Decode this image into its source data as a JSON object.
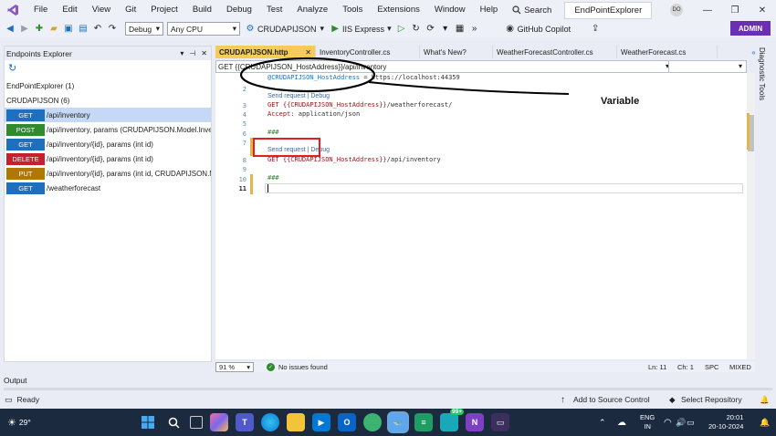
{
  "menubar": {
    "items": [
      "File",
      "Edit",
      "View",
      "Git",
      "Project",
      "Build",
      "Debug",
      "Test",
      "Analyze",
      "Tools",
      "Extensions",
      "Window",
      "Help"
    ],
    "search_label": "Search",
    "window_title": "EndPointExplorer",
    "avatar_initials": "DO"
  },
  "toolbar": {
    "config": "Debug",
    "platform": "Any CPU",
    "startup_project": "CRUDAPIJSON",
    "run_target": "IIS Express",
    "copilot": "GitHub Copilot",
    "admin": "ADMIN"
  },
  "left_panel": {
    "title": "Endpoints Explorer",
    "root": "EndPointExplorer (1)",
    "project": "CRUDAPIJSON (6)",
    "endpoints": [
      {
        "verb": "GET",
        "path": "/api/inventory",
        "color": "#1f6fbf"
      },
      {
        "verb": "POST",
        "path": "/api/inventory, params (CRUDAPIJSON.Model.Inver",
        "color": "#2e8b2e"
      },
      {
        "verb": "GET",
        "path": "/api/inventory/{id}, params (int id)",
        "color": "#1f6fbf"
      },
      {
        "verb": "DELETE",
        "path": "/api/inventory/{id}, params (int id)",
        "color": "#c8202a"
      },
      {
        "verb": "PUT",
        "path": "/api/inventory/{id}, params (int id, CRUDAPIJSON.M",
        "color": "#b07800"
      },
      {
        "verb": "GET",
        "path": "/weatherforecast",
        "color": "#1f6fbf"
      }
    ]
  },
  "tabs": [
    "CRUDAPIJSON.http",
    "InventoryController.cs",
    "What's New?",
    "WeatherForecastController.cs",
    "WeatherForecast.cs"
  ],
  "editor": {
    "address_bar": "GET {{CRUDAPIJSON_HostAddress}}/api/inventory",
    "lines": {
      "l1_var": "@CRUDAPIJSON_HostAddress",
      "l1_val": " = https://localhost:44359",
      "lens_send": "Send request",
      "lens_sep": " | ",
      "lens_debug": "Debug",
      "l3_verb": "GET ",
      "l3_var": "{{CRUDAPIJSON_HostAddress}}",
      "l3_path": "/weatherforecast/",
      "l4_header": "Accept",
      "l4_value": ": application/json",
      "sep": "###",
      "l8_verb": "GET ",
      "l8_var": "{{CRUDAPIJSON_HostAddress}}",
      "l8_path": "/api/inventory"
    },
    "line_numbers": [
      "2",
      "3",
      "4",
      "5",
      "6",
      "7",
      "8",
      "9",
      "10",
      "11"
    ],
    "annotation": "Variable"
  },
  "editor_status": {
    "zoom": "91 %",
    "issues": "No issues found",
    "ln": "Ln: 11",
    "ch": "Ch: 1",
    "ws": "SPC",
    "eol": "MIXED"
  },
  "right_strip": {
    "label": "Diagnostic Tools"
  },
  "output": {
    "label": "Output"
  },
  "statusbar": {
    "ready": "Ready",
    "source_control": "Add to Source Control",
    "repo": "Select Repository"
  },
  "taskbar": {
    "weather": "29°",
    "lang1": "ENG",
    "lang2": "IN",
    "time": "20:01",
    "date": "20-10-2024",
    "badge": "99+"
  }
}
